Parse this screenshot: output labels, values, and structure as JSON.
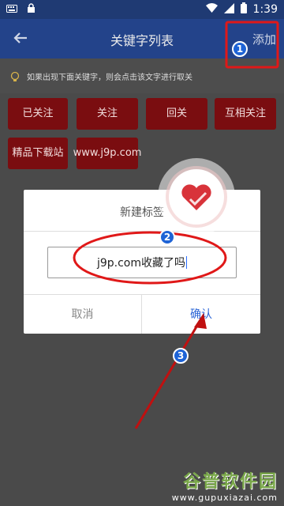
{
  "status_bar": {
    "time": "1:39"
  },
  "app_bar": {
    "title": "关键字列表",
    "add_label": "添加"
  },
  "hint": {
    "text": "如果出现下面关键字，则会点击该文字进行取关"
  },
  "keywords": [
    "已关注",
    "关注",
    "回关",
    "互相关注",
    "精品下载站",
    "www.j9p.com"
  ],
  "dialog": {
    "title": "新建标签",
    "input_value": "j9p.com收藏了吗",
    "cancel_label": "取消",
    "confirm_label": "确认"
  },
  "annotations": {
    "step1": "1",
    "step2": "2",
    "step3": "3"
  },
  "watermark": {
    "main": "谷普软件园",
    "sub": "www.gupuxiazai.com"
  },
  "colors": {
    "app_bar": "#23438a",
    "chip": "#7a0d10",
    "annotation": "#e01818",
    "confirm": "#2a64d6"
  }
}
